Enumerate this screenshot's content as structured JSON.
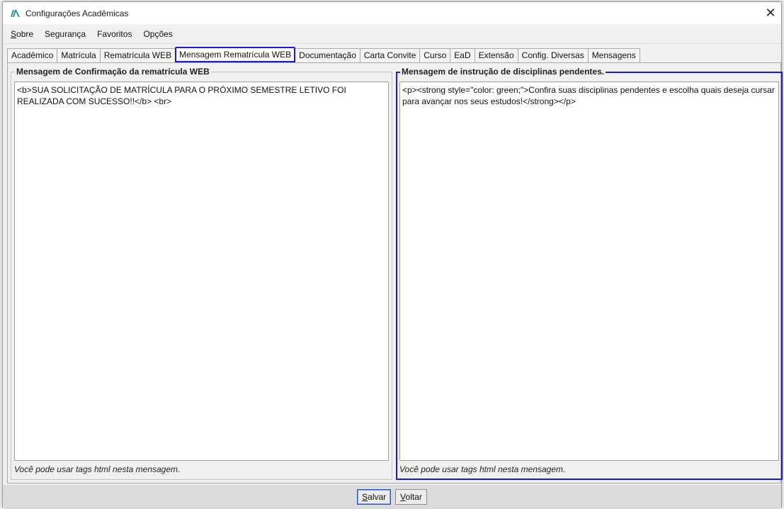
{
  "window": {
    "title": "Configurações Acadêmicas",
    "close_label": "✕"
  },
  "menu": [
    {
      "mnemonic": "S",
      "rest": "obre"
    },
    {
      "mnemonic": "",
      "rest": "Segurança"
    },
    {
      "mnemonic": "",
      "rest": "Favoritos"
    },
    {
      "mnemonic": "",
      "rest": "Opções"
    }
  ],
  "tabs": [
    "Acadêmico",
    "Matrícula",
    "Rematrícula WEB",
    "Mensagem Rematrícula WEB",
    "Documentação",
    "Carta Convite",
    "Curso",
    "EaD",
    "Extensão",
    "Config. Diversas",
    "Mensagens"
  ],
  "active_tab_index": 3,
  "left_panel": {
    "legend": "Mensagem de Confirmação da rematrícula WEB",
    "content": "<b>SUA SOLICITAÇÃO DE MATRÍCULA PARA O PRÓXIMO SEMESTRE LETIVO FOI REALIZADA COM SUCESSO!!</b> <br>",
    "hint": "Você pode usar tags html nesta mensagem."
  },
  "right_panel": {
    "legend": "Mensagem de instrução de disciplinas pendentes.",
    "content": "<p><strong style=\"color: green;\">Confira suas disciplinas pendentes e escolha quais deseja cursar para avançar nos seus estudos!</strong></p>",
    "hint": "Você pode usar tags html nesta mensagem."
  },
  "buttons": {
    "save": {
      "mnemonic": "S",
      "rest": "alvar"
    },
    "back": {
      "mnemonic": "V",
      "rest": "oltar"
    }
  },
  "colors": {
    "highlight": "#1a1ad6",
    "window_bg": "#f0f0f0"
  }
}
